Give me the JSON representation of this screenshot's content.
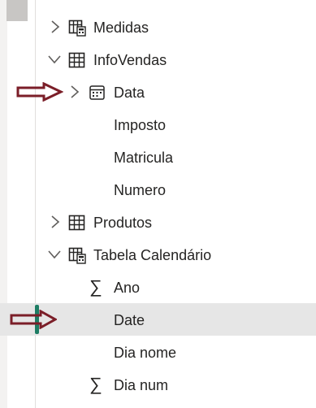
{
  "tree": {
    "items": [
      {
        "label": "Medidas",
        "expanded": false,
        "icon": "measure-table-icon"
      },
      {
        "label": "InfoVendas",
        "expanded": true,
        "icon": "table-icon"
      },
      {
        "label": "Data",
        "expanded": false,
        "icon": "calendar-hierarchy-icon"
      },
      {
        "label": "Imposto"
      },
      {
        "label": "Matricula"
      },
      {
        "label": "Numero"
      },
      {
        "label": "Produtos",
        "expanded": false,
        "icon": "table-icon"
      },
      {
        "label": "Tabela Calendário",
        "expanded": true,
        "icon": "measure-table-icon"
      },
      {
        "label": "Ano",
        "icon": "sigma-icon",
        "glyph": "∑"
      },
      {
        "label": "Date",
        "selected": true
      },
      {
        "label": "Dia nome"
      },
      {
        "label": "Dia num",
        "icon": "sigma-icon",
        "glyph": "∑"
      }
    ]
  },
  "colors": {
    "annotation_arrow": "#7b1e28",
    "selection_bar": "#1e7d64",
    "selected_row": "#e6e6e6",
    "text": "#252423"
  },
  "annotations": {
    "arrows": [
      {
        "points_to": "Data"
      },
      {
        "points_to": "Date"
      }
    ]
  }
}
